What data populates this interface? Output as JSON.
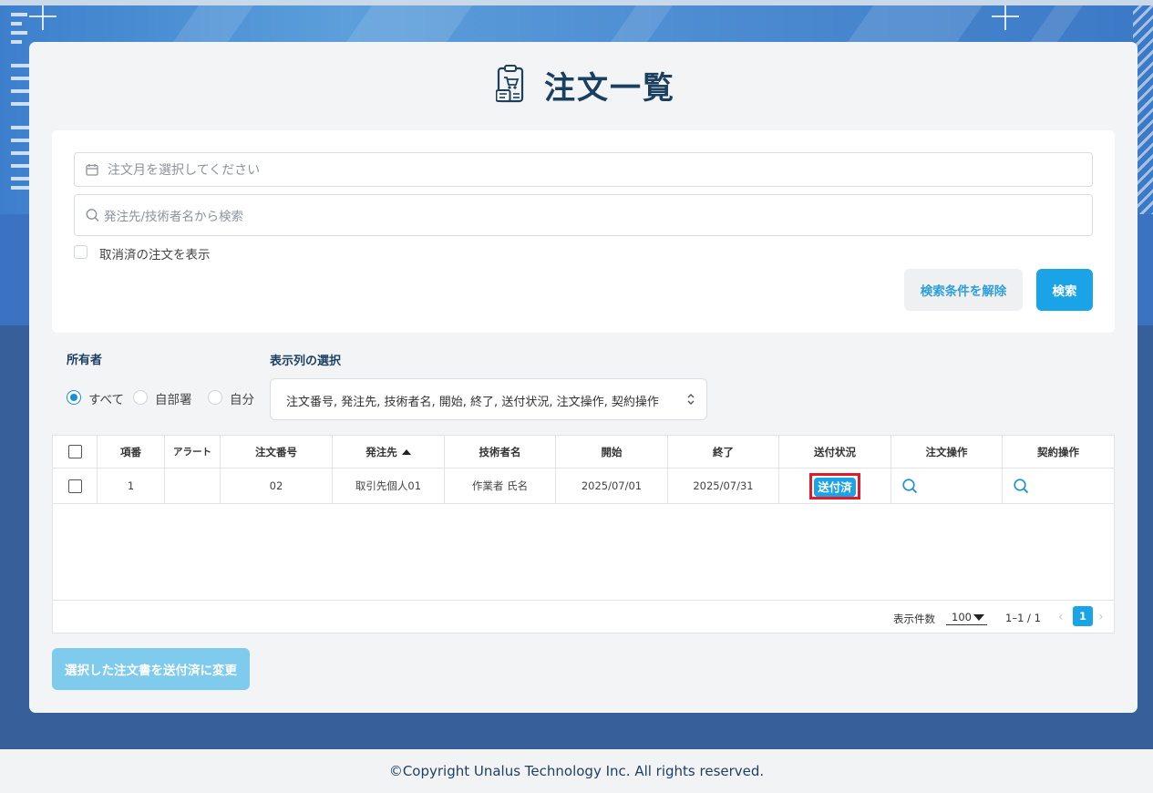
{
  "page": {
    "title": "注文一覧"
  },
  "search": {
    "month_placeholder": "注文月を選択してください",
    "keyword_placeholder": "発注先/技術者名から検索",
    "show_cancelled_label": "取消済の注文を表示",
    "clear_label": "検索条件を解除",
    "search_label": "検索"
  },
  "filters": {
    "owner_label": "所有者",
    "owner_options": [
      "すべて",
      "自部署",
      "自分"
    ],
    "owner_selected": "すべて",
    "columns_label": "表示列の選択",
    "columns_value": "注文番号, 発注先, 技術者名, 開始, 終了, 送付状況, 注文操作, 契約操作"
  },
  "table": {
    "headers": [
      "項番",
      "アラート",
      "注文番号",
      "発注先",
      "技術者名",
      "開始",
      "終了",
      "送付状況",
      "注文操作",
      "契約操作"
    ],
    "sorted_column": "発注先",
    "rows": [
      {
        "index": "1",
        "alert": "",
        "order_no": "02",
        "supplier": "取引先個人01",
        "engineer": "作業者 氏名",
        "start": "2025/07/01",
        "end": "2025/07/31",
        "status": "送付済"
      }
    ]
  },
  "pagination": {
    "per_page_label": "表示件数",
    "per_page_value": "100",
    "range": "1–1 / 1",
    "current_page": "1"
  },
  "bulk_action_label": "選択した注文書を送付済に変更",
  "footer": {
    "copyright": "©Copyright Unalus Technology Inc. All rights reserved."
  },
  "colors": {
    "accent": "#1aa3e6",
    "title": "#1b3f5f",
    "highlight": "#e01b2a",
    "bg_dark": "#375f99"
  }
}
